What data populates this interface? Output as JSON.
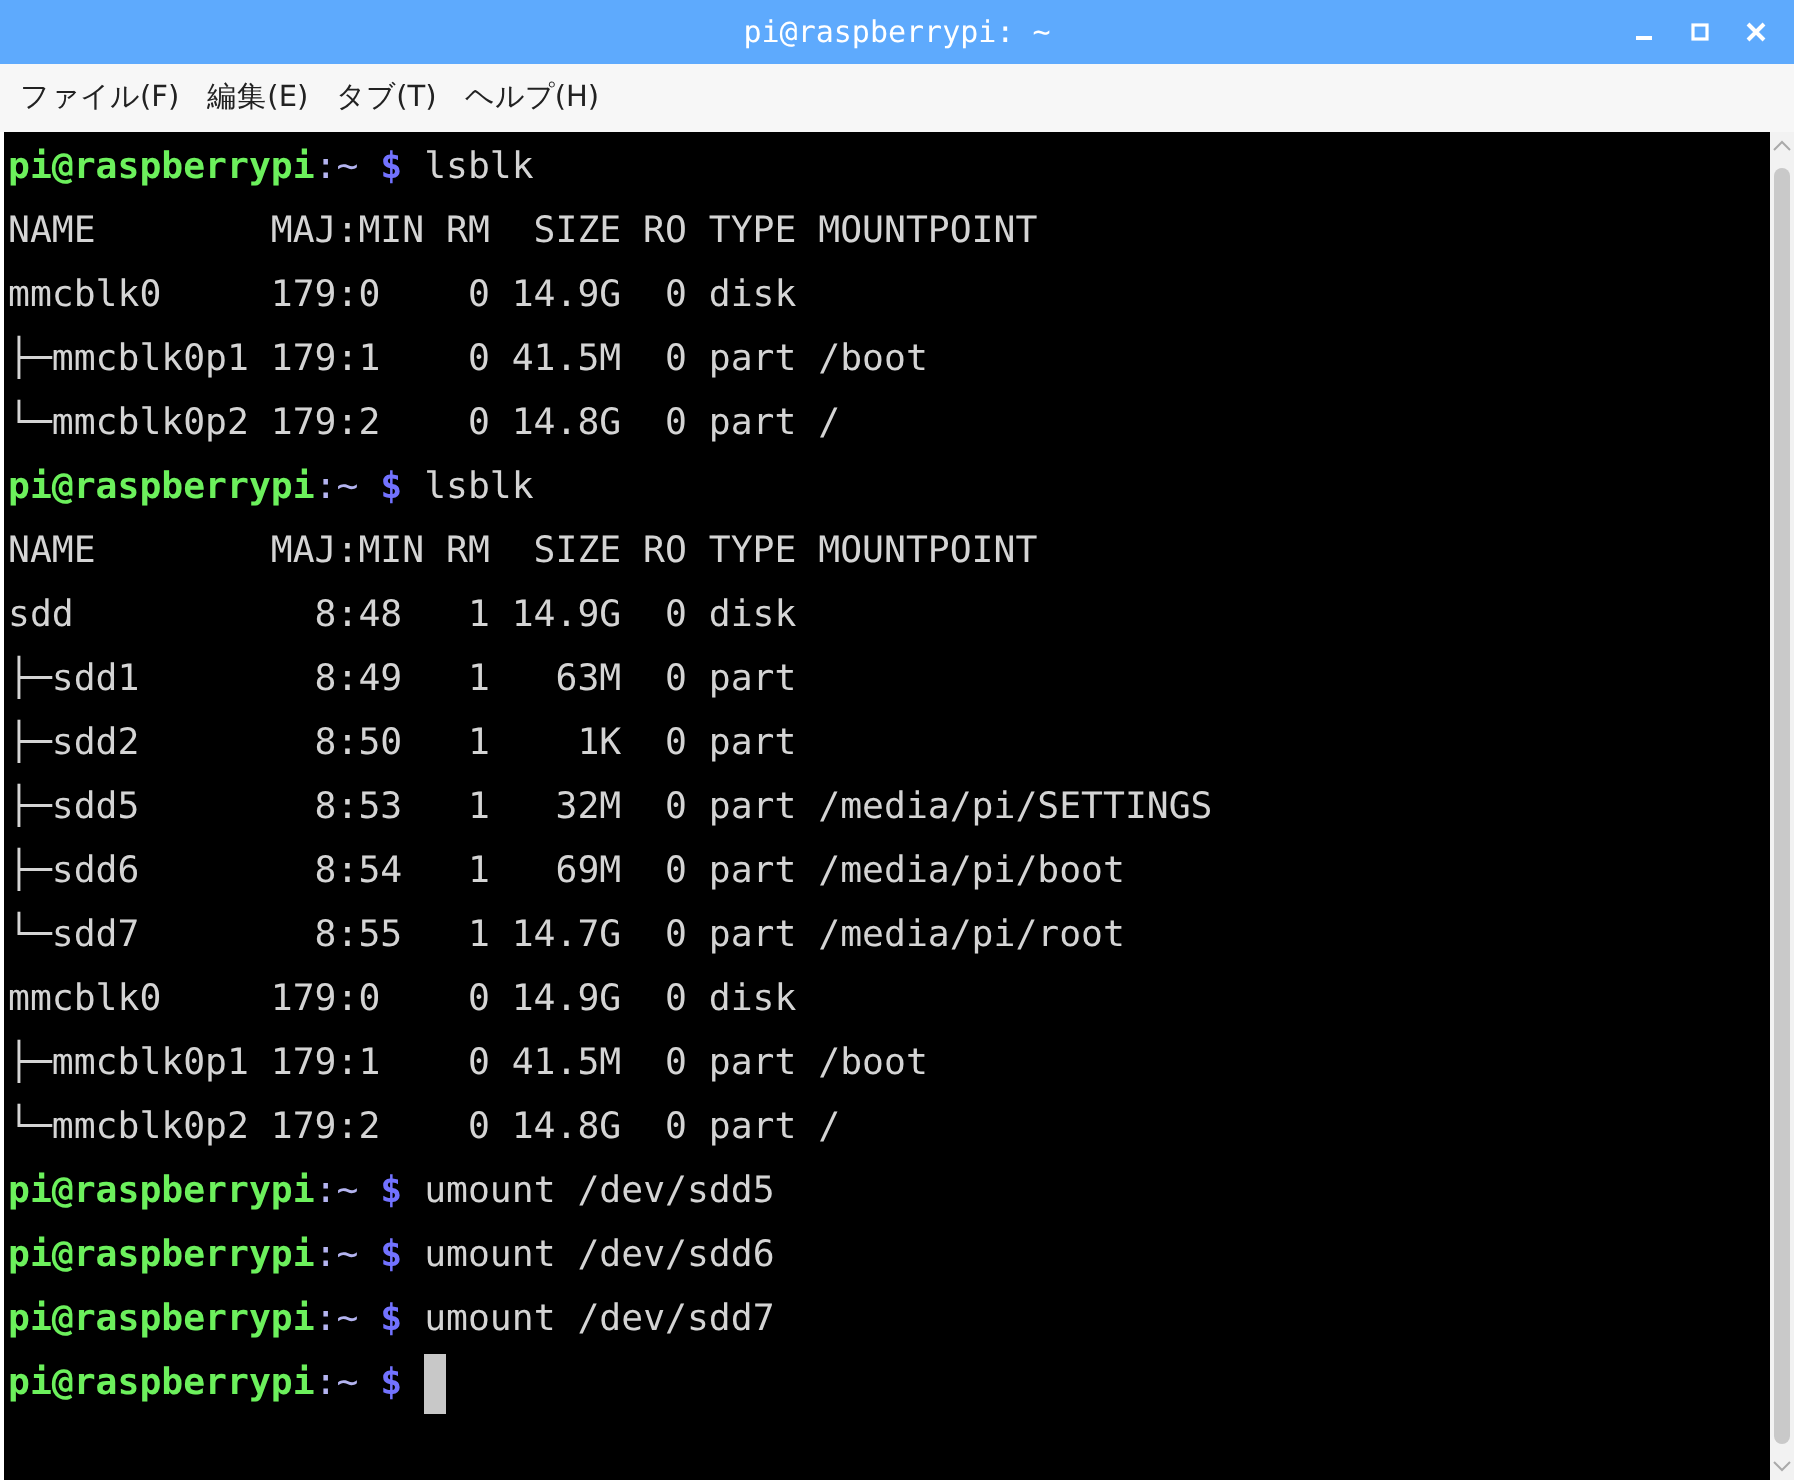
{
  "window": {
    "title": "pi@raspberrypi: ~"
  },
  "menu": [
    {
      "label": "ファイル(F)"
    },
    {
      "label": "編集(E)"
    },
    {
      "label": "タブ(T)"
    },
    {
      "label": "ヘルプ(H)"
    }
  ],
  "terminal": {
    "lines": [
      {
        "kind": "prompt",
        "user_host": "pi@raspberrypi",
        "path": ":~",
        "symbol": "$",
        "command": "lsblk",
        "cursor": false
      },
      {
        "kind": "output",
        "text": "NAME        MAJ:MIN RM  SIZE RO TYPE MOUNTPOINT"
      },
      {
        "kind": "output",
        "text": "mmcblk0     179:0    0 14.9G  0 disk"
      },
      {
        "kind": "output",
        "text": "├─mmcblk0p1 179:1    0 41.5M  0 part /boot"
      },
      {
        "kind": "output",
        "text": "└─mmcblk0p2 179:2    0 14.8G  0 part /"
      },
      {
        "kind": "prompt",
        "user_host": "pi@raspberrypi",
        "path": ":~",
        "symbol": "$",
        "command": "lsblk",
        "cursor": false
      },
      {
        "kind": "output",
        "text": "NAME        MAJ:MIN RM  SIZE RO TYPE MOUNTPOINT"
      },
      {
        "kind": "output",
        "text": "sdd           8:48   1 14.9G  0 disk"
      },
      {
        "kind": "output",
        "text": "├─sdd1        8:49   1   63M  0 part"
      },
      {
        "kind": "output",
        "text": "├─sdd2        8:50   1    1K  0 part"
      },
      {
        "kind": "output",
        "text": "├─sdd5        8:53   1   32M  0 part /media/pi/SETTINGS"
      },
      {
        "kind": "output",
        "text": "├─sdd6        8:54   1   69M  0 part /media/pi/boot"
      },
      {
        "kind": "output",
        "text": "└─sdd7        8:55   1 14.7G  0 part /media/pi/root"
      },
      {
        "kind": "output",
        "text": "mmcblk0     179:0    0 14.9G  0 disk"
      },
      {
        "kind": "output",
        "text": "├─mmcblk0p1 179:1    0 41.5M  0 part /boot"
      },
      {
        "kind": "output",
        "text": "└─mmcblk0p2 179:2    0 14.8G  0 part /"
      },
      {
        "kind": "prompt",
        "user_host": "pi@raspberrypi",
        "path": ":~",
        "symbol": "$",
        "command": "umount /dev/sdd5",
        "cursor": false
      },
      {
        "kind": "prompt",
        "user_host": "pi@raspberrypi",
        "path": ":~",
        "symbol": "$",
        "command": "umount /dev/sdd6",
        "cursor": false
      },
      {
        "kind": "prompt",
        "user_host": "pi@raspberrypi",
        "path": ":~",
        "symbol": "$",
        "command": "umount /dev/sdd7",
        "cursor": false
      },
      {
        "kind": "prompt",
        "user_host": "pi@raspberrypi",
        "path": ":~",
        "symbol": "$",
        "cursor": true
      }
    ]
  }
}
